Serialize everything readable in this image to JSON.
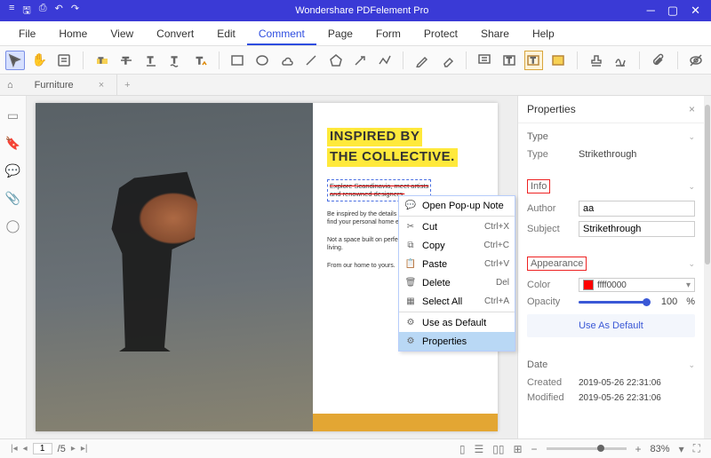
{
  "titlebar": {
    "title": "Wondershare PDFelement Pro"
  },
  "menubar": {
    "items": [
      "File",
      "Home",
      "View",
      "Convert",
      "Edit",
      "Comment",
      "Page",
      "Form",
      "Protect",
      "Share",
      "Help"
    ],
    "active": "Comment"
  },
  "tabs": {
    "doc_name": "Furniture"
  },
  "document": {
    "headline1": "INSPIRED BY",
    "headline2": "THE COLLECTIVE.",
    "strike1": "Explore Scandinavia, meet artists",
    "strike2": "and renowned designers.",
    "para1": "Be inspired by the details of finest design and passion to find your personal home expression.",
    "para2": "Not a space built on perfection but a home made for living.",
    "para3": "From our home to yours."
  },
  "context_menu": {
    "open_popup": "Open Pop-up Note",
    "cut": "Cut",
    "cut_sc": "Ctrl+X",
    "copy": "Copy",
    "copy_sc": "Ctrl+C",
    "paste": "Paste",
    "paste_sc": "Ctrl+V",
    "delete": "Delete",
    "delete_sc": "Del",
    "select_all": "Select All",
    "select_all_sc": "Ctrl+A",
    "use_default": "Use as Default",
    "properties": "Properties"
  },
  "properties": {
    "panel_title": "Properties",
    "type_section": "Type",
    "type_label": "Type",
    "type_value": "Strikethrough",
    "info_section": "Info",
    "author_label": "Author",
    "author_value": "aa",
    "subject_label": "Subject",
    "subject_value": "Strikethrough",
    "appearance_section": "Appearance",
    "color_label": "Color",
    "color_value": "ffff0000",
    "opacity_label": "Opacity",
    "opacity_value": "100",
    "opacity_unit": "%",
    "use_as_default": "Use As Default",
    "date_section": "Date",
    "created_label": "Created",
    "created_value": "2019-05-26 22:31:06",
    "modified_label": "Modified",
    "modified_value": "2019-05-26 22:31:06"
  },
  "statusbar": {
    "page_current": "1",
    "page_total": "/5",
    "zoom": "83%"
  }
}
